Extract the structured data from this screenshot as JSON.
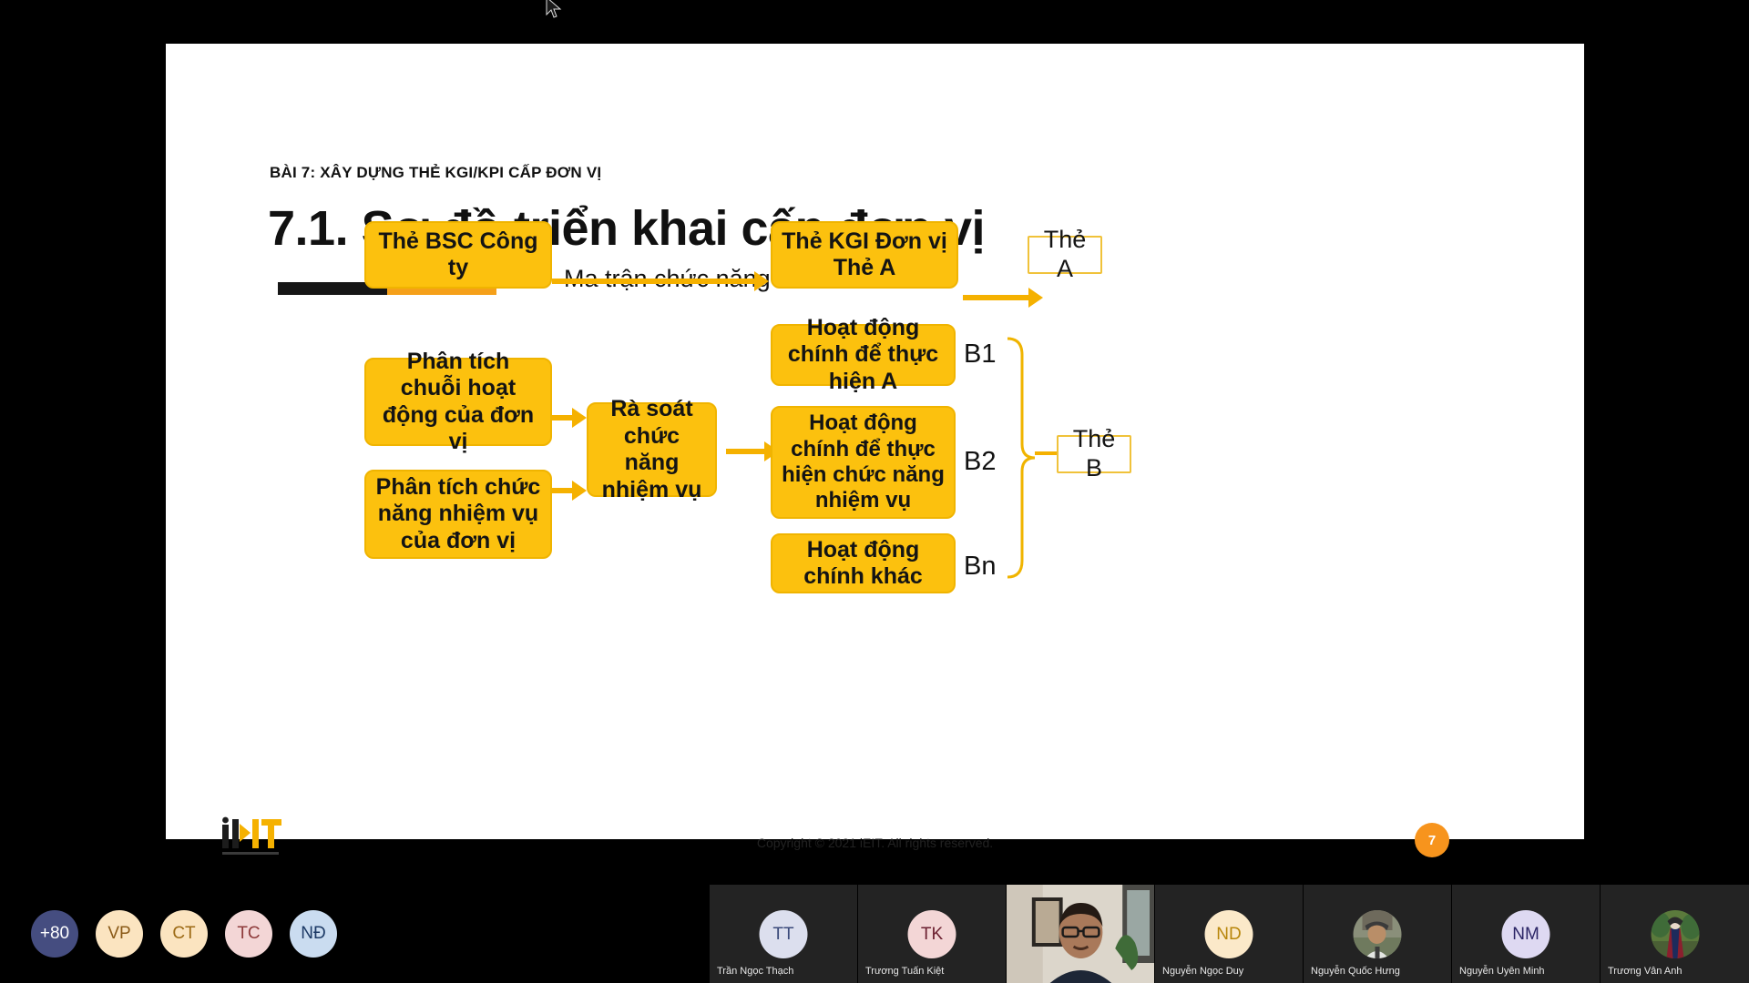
{
  "slide": {
    "kicker": "BÀI 7: XÂY DỰNG THẺ KGI/KPI CẤP ĐƠN VỊ",
    "title": "7.1. Sơ đồ triển khai cấp đơn vị",
    "copyright": "Copyright © 2021 iEIT. All rights reserved.",
    "page_number": "7",
    "logo_text": "iEIT",
    "accent_color": "#f5a01a",
    "node_fill": "#fcc10e"
  },
  "diagram": {
    "nodes": [
      {
        "id": "bsc",
        "label": "Thẻ BSC Công ty"
      },
      {
        "id": "kgi",
        "label": "Thẻ KGI Đơn vị\nThẻ A"
      },
      {
        "id": "the_a",
        "label": "Thẻ A"
      },
      {
        "id": "chuoi",
        "label": "Phân tích chuỗi hoạt động của đơn vị"
      },
      {
        "id": "chucnang",
        "label": "Phân tích chức năng nhiệm vụ của đơn vị"
      },
      {
        "id": "rasoat",
        "label": "Rà soát chức năng nhiệm vụ"
      },
      {
        "id": "b1",
        "label": "Hoạt động chính để thực hiện A"
      },
      {
        "id": "b2",
        "label": "Hoạt động chính để thực hiện chức năng nhiệm vụ"
      },
      {
        "id": "bn",
        "label": "Hoạt động chính khác"
      },
      {
        "id": "the_b",
        "label": "Thẻ B"
      }
    ],
    "edge_label": "Ma trận chức năng",
    "branch_labels": [
      "B1",
      "B2",
      "Bn"
    ]
  },
  "filmstrip": {
    "overflow_badge": {
      "label": "+80",
      "bg": "#454d80",
      "fg": "#ffffff"
    },
    "avatars": [
      {
        "initials": "VP",
        "bg": "#fbe4c0",
        "fg": "#8a5a18"
      },
      {
        "initials": "CT",
        "bg": "#fbe4c0",
        "fg": "#9c6a15"
      },
      {
        "initials": "TC",
        "bg": "#f3d6d6",
        "fg": "#8e3b3b"
      },
      {
        "initials": "NĐ",
        "bg": "#cadcf0",
        "fg": "#1d3a66"
      }
    ],
    "tiles": [
      {
        "name": "Trần Ngọc Thạch",
        "initials": "TT",
        "bg": "#dcdfee",
        "fg": "#3a4a7a",
        "kind": "initials"
      },
      {
        "name": "Trương Tuấn Kiệt",
        "initials": "TK",
        "bg": "#f3d6d6",
        "fg": "#6b2030",
        "kind": "initials"
      },
      {
        "name": "",
        "initials": "",
        "bg": "",
        "fg": "",
        "kind": "video"
      },
      {
        "name": "Nguyễn Ngọc Duy",
        "initials": "ND",
        "bg": "#fbe9c9",
        "fg": "#b8860b",
        "kind": "initials"
      },
      {
        "name": "Nguyễn Quốc Hưng",
        "initials": "",
        "bg": "",
        "fg": "",
        "kind": "photo-hat"
      },
      {
        "name": "Nguyễn Uyên Minh",
        "initials": "NM",
        "bg": "#ded9f2",
        "fg": "#2b2566",
        "kind": "initials"
      },
      {
        "name": "Trương Vân Anh",
        "initials": "",
        "bg": "",
        "fg": "",
        "kind": "photo-ao"
      }
    ]
  }
}
